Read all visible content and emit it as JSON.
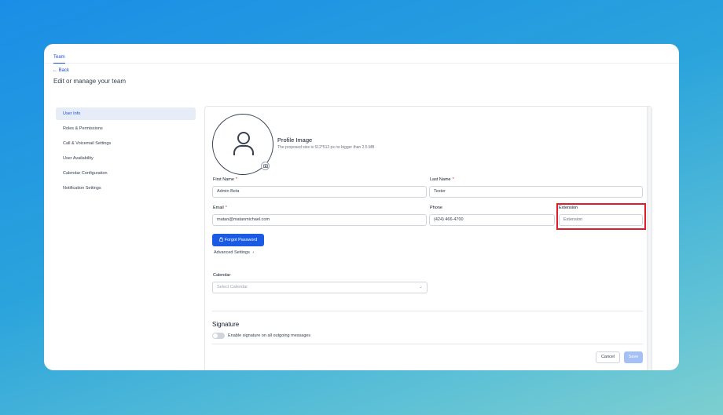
{
  "header": {
    "tab": "Team",
    "back": "Back",
    "title": "Edit or manage your team"
  },
  "sidebar": {
    "items": [
      {
        "label": "User Info",
        "active": true
      },
      {
        "label": "Roles & Permissions"
      },
      {
        "label": "Call & Voicemail Settings"
      },
      {
        "label": "User Availability"
      },
      {
        "label": "Calendar Configuration"
      },
      {
        "label": "Notification Settings"
      }
    ]
  },
  "profile": {
    "title": "Profile Image",
    "subtitle": "The proposed size is 512*512 px no bigger than 2.5 MB"
  },
  "form": {
    "first_name_label": "First Name",
    "first_name_value": "Admin Beta",
    "last_name_label": "Last Name",
    "last_name_value": "Tester",
    "email_label": "Email",
    "email_value": "matan@matanmichael.com",
    "phone_label": "Phone",
    "phone_value": "(424) 466-4700",
    "extension_label": "Extension",
    "extension_placeholder": "Extension",
    "required_mark": "*",
    "forgot_password": "Forgot Password",
    "advanced_settings": "Advanced Settings",
    "calendar_label": "Calendar",
    "calendar_placeholder": "Select Calendar"
  },
  "signature": {
    "title": "Signature",
    "toggle_label": "Enable signature on all outgoing messages",
    "enabled": false
  },
  "actions": {
    "cancel": "Cancel",
    "save": "Save"
  },
  "colors": {
    "accent": "#1a5be6",
    "highlight": "#e11d2a",
    "required": "#dc2626"
  }
}
